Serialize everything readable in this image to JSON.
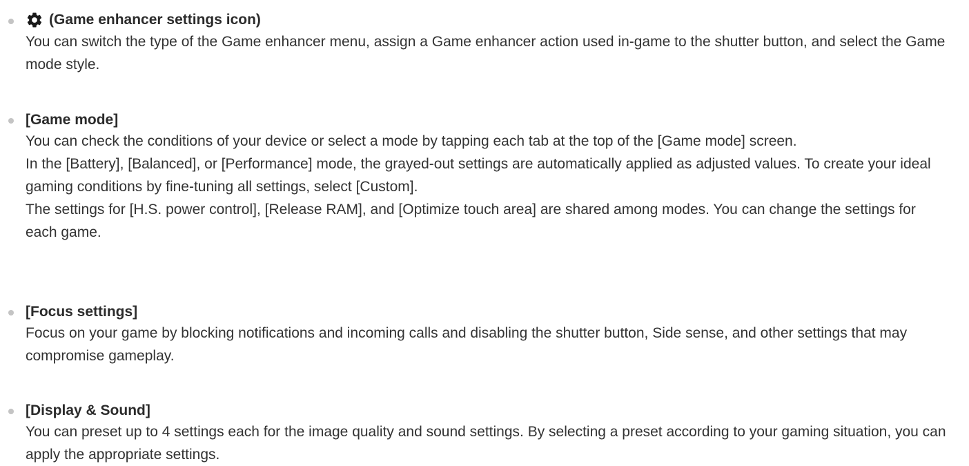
{
  "items": [
    {
      "icon": "gear-icon",
      "title": "(Game enhancer settings icon)",
      "paragraphs": [
        "You can switch the type of the Game enhancer menu, assign a Game enhancer action used in-game to the shutter button, and select the Game mode style."
      ]
    },
    {
      "title": "[Game mode]",
      "paragraphs": [
        "You can check the conditions of your device or select a mode by tapping each tab at the top of the [Game mode] screen.",
        "In the [Battery], [Balanced], or [Performance] mode, the grayed-out settings are automatically applied as adjusted values. To create your ideal gaming conditions by fine-tuning all settings, select [Custom].",
        "The settings for [H.S. power control], [Release RAM], and [Optimize touch area] are shared among modes. You can change the settings for each game."
      ]
    },
    {
      "title": "[Focus settings]",
      "paragraphs": [
        "Focus on your game by blocking notifications and incoming calls and disabling the shutter button, Side sense, and other settings that may compromise gameplay."
      ]
    },
    {
      "title": "[Display & Sound]",
      "paragraphs": [
        "You can preset up to 4 settings each for the image quality and sound settings. By selecting a preset according to your gaming situation, you can apply the appropriate settings."
      ]
    }
  ]
}
